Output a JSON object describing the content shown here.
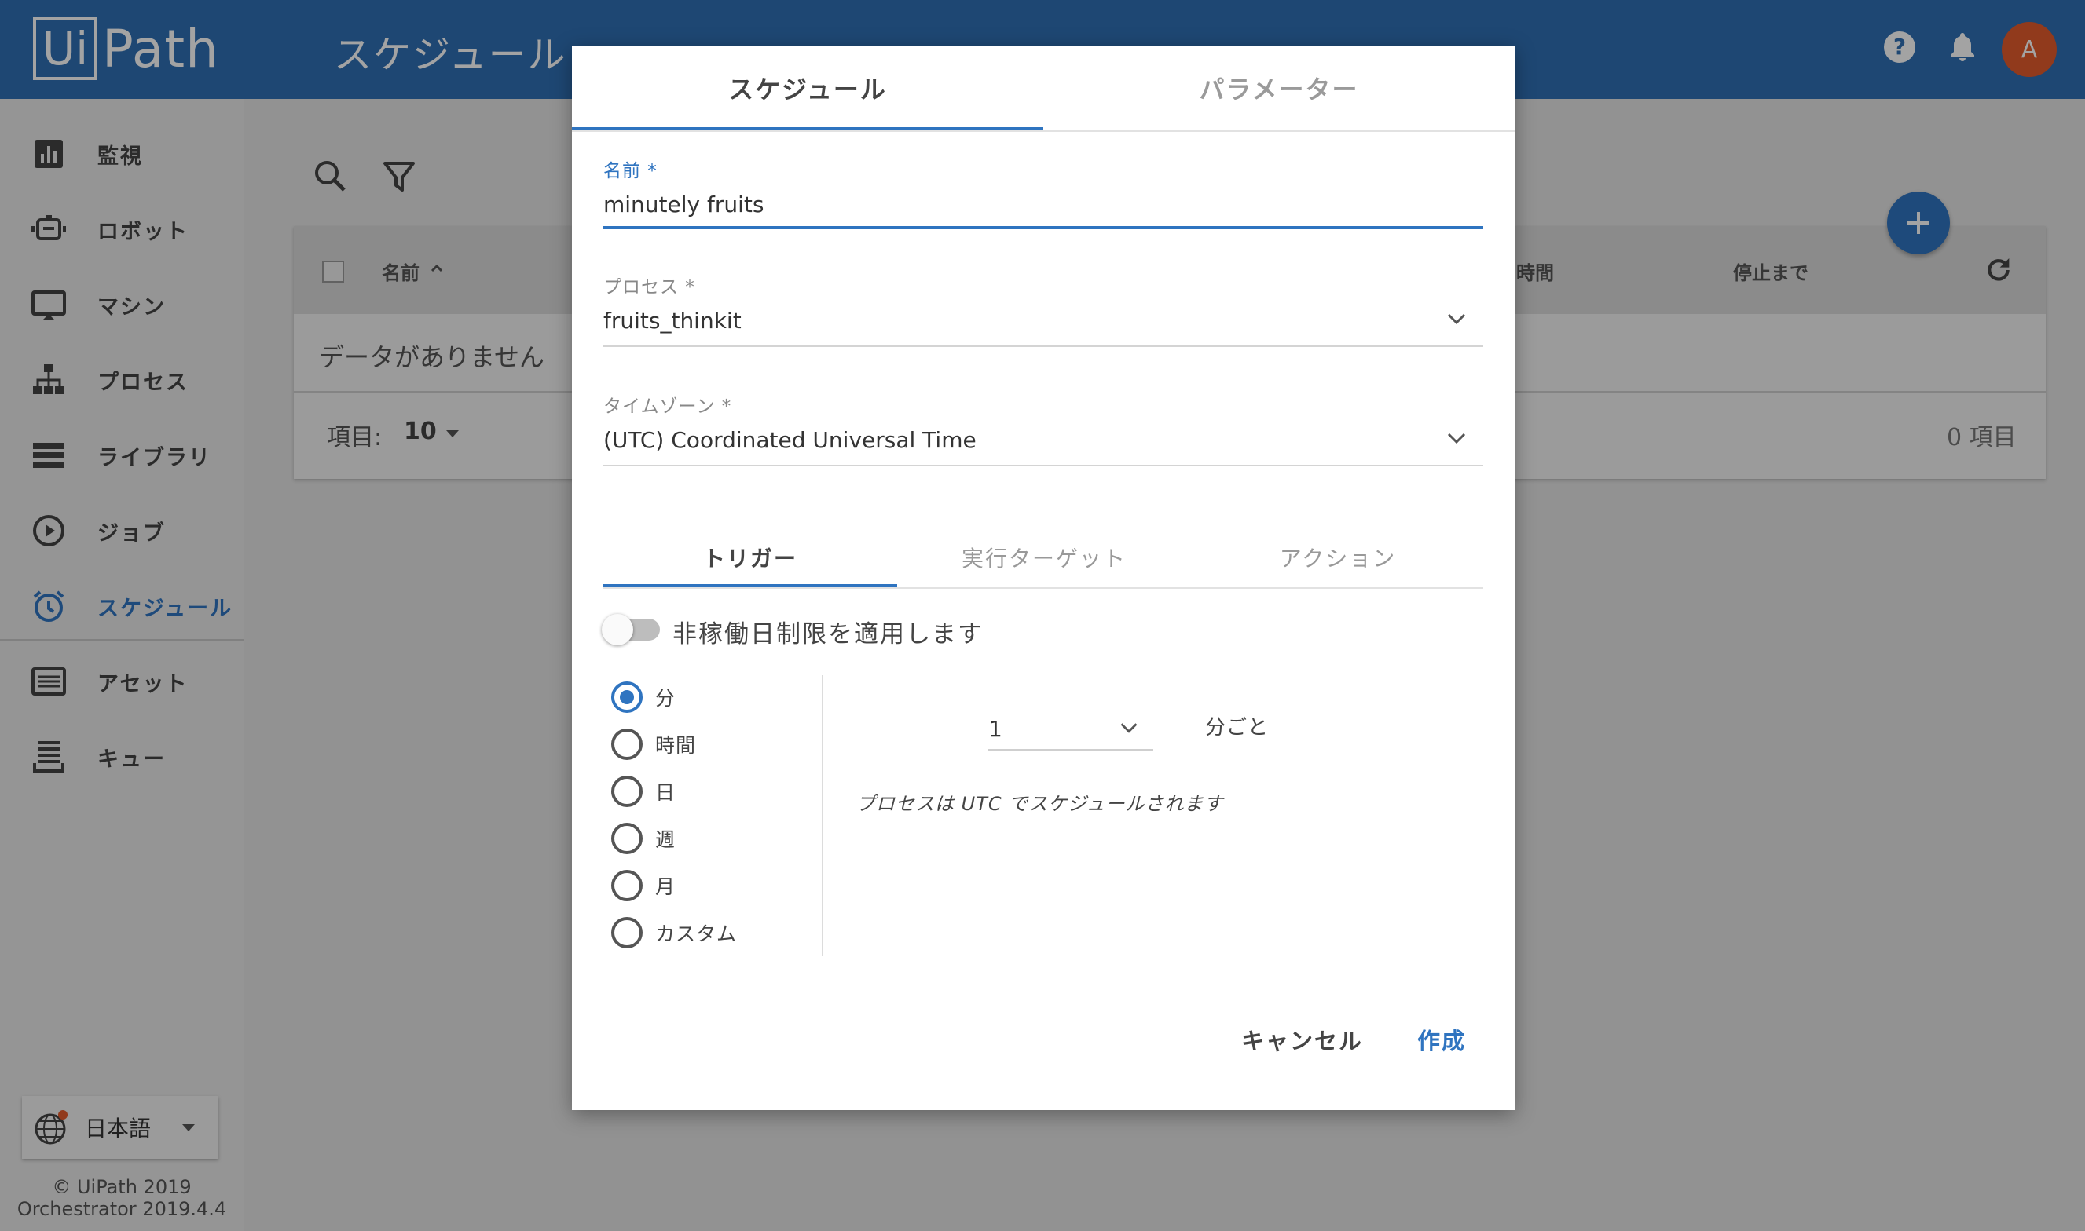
{
  "app": {
    "logo_ui": "Ui",
    "logo_rest": "Path",
    "page_title": "スケジュール",
    "avatar_initial": "A"
  },
  "sidebar": {
    "items": [
      {
        "label": "監視"
      },
      {
        "label": "ロボット"
      },
      {
        "label": "マシン"
      },
      {
        "label": "プロセス"
      },
      {
        "label": "ライブラリ"
      },
      {
        "label": "ジョブ"
      },
      {
        "label": "スケジュール",
        "active": true
      },
      {
        "label": "アセット"
      },
      {
        "label": "キュー"
      }
    ],
    "language": "日本語",
    "copyright": "© UiPath 2019",
    "version": "Orchestrator 2019.4.4"
  },
  "table": {
    "col_name": "名前",
    "col_time": "時間",
    "col_until": "停止まで",
    "empty_text": "データがありません",
    "items_label": "項目:",
    "items_per_page": "10",
    "total_items": "0 項目"
  },
  "dialog": {
    "tabs": [
      "スケジュール",
      "パラメーター"
    ],
    "name_label": "名前 *",
    "name_value": "minutely fruits",
    "process_label": "プロセス *",
    "process_value": "fruits_thinkit",
    "timezone_label": "タイムゾーン *",
    "timezone_value": "(UTC) Coordinated Universal Time",
    "sub_tabs": [
      "トリガー",
      "実行ターゲット",
      "アクション"
    ],
    "nonworking_toggle_label": "非稼働日制限を適用します",
    "frequency_options": [
      "分",
      "時間",
      "日",
      "週",
      "月",
      "カスタム"
    ],
    "frequency_selected": "分",
    "interval_value": "1",
    "interval_unit": "分ごと",
    "timezone_note": "プロセスは UTC でスケジュールされます",
    "cancel_label": "キャンセル",
    "create_label": "作成"
  },
  "colors": {
    "primary": "#2f74c0",
    "topbar": "#2f6fb4",
    "avatar": "#e35b2c"
  }
}
